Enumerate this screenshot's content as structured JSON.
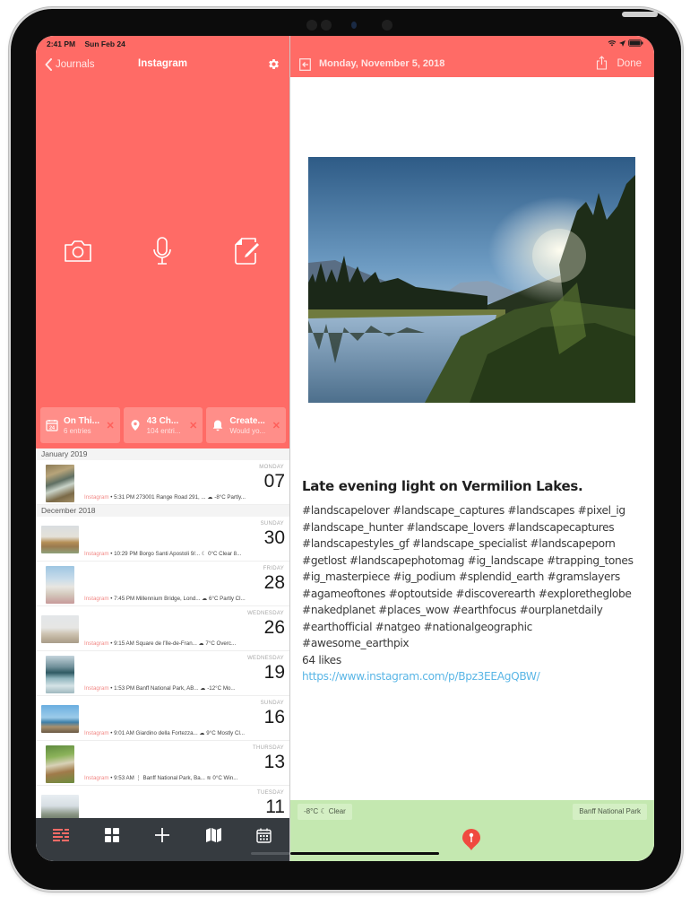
{
  "colors": {
    "accent": "#ff6b66",
    "card": "#ff8e89",
    "tabbar": "#363b40",
    "tab_active": "#ff6b66",
    "link": "#5ab6e6",
    "map": "#c4e8b0",
    "pin": "#f04a3f"
  },
  "status_bar": {
    "time": "2:41 PM",
    "date": "Sun Feb 24",
    "icons": [
      "wifi-icon",
      "location-arrow-icon",
      "battery-icon"
    ]
  },
  "left_nav": {
    "back_label": "Journals",
    "title": "Instagram",
    "settings_icon": "gear-icon"
  },
  "quick_actions": [
    {
      "icon": "camera-icon",
      "label": "Camera"
    },
    {
      "icon": "microphone-icon",
      "label": "Audio"
    },
    {
      "icon": "new-entry-icon",
      "label": "New Entry"
    }
  ],
  "cards": [
    {
      "icon": "calendar-24-icon",
      "title": "On Thi...",
      "subtitle": "6 entries"
    },
    {
      "icon": "location-pin-icon",
      "title": "43 Ch...",
      "subtitle": "104 entri..."
    },
    {
      "icon": "bell-icon",
      "title": "Create...",
      "subtitle": "Would yo..."
    }
  ],
  "sections": [
    {
      "header": "January 2019",
      "entries": [
        {
          "weekday": "MONDAY",
          "day": "07",
          "journal": "Instagram",
          "meta": " • 5:31 PM 273001 Range Road 291, ...  ☁ -8°C Partly...",
          "thumb": "waterfall"
        }
      ]
    },
    {
      "header": "December 2018",
      "entries": [
        {
          "weekday": "SUNDAY",
          "day": "30",
          "journal": "Instagram",
          "meta": " • 10:29 PM Borgo Santi Apostoli 9/...  ☾ 0°C Clear  8...",
          "thumb": "bridge"
        },
        {
          "weekday": "FRIDAY",
          "day": "28",
          "journal": "Instagram",
          "meta": " • 7:45 PM Millennium Bridge, Lond...  ☁ 6°C Partly Cl...",
          "thumb": "cathedral"
        },
        {
          "weekday": "WEDNESDAY",
          "day": "26",
          "journal": "Instagram",
          "meta": " • 9:15 AM Square de l'Île-de-Fran...  ☁ 7°C Overc...",
          "thumb": "paris"
        },
        {
          "weekday": "WEDNESDAY",
          "day": "19",
          "journal": "Instagram",
          "meta": " • 1:53 PM Banff National Park, AB...  ☁ -12°C Mo...",
          "thumb": "lake"
        },
        {
          "weekday": "SUNDAY",
          "day": "16",
          "journal": "Instagram",
          "meta": " • 9:01 AM Giardino della Fortezza...  ☁ 9°C Mostly Cl...",
          "thumb": "sea"
        },
        {
          "weekday": "THURSDAY",
          "day": "13",
          "journal": "Instagram",
          "meta": " • 9:53 AM  ⋮  Banff National Park, Ba...  ≋ 0°C Win...",
          "thumb": "garden"
        },
        {
          "weekday": "TUESDAY",
          "day": "11",
          "journal": "",
          "meta": "",
          "thumb": "snow"
        }
      ]
    }
  ],
  "tabbar": [
    {
      "icon": "timeline-list-icon",
      "label": "List",
      "active": true
    },
    {
      "icon": "media-grid-icon",
      "label": "Media",
      "active": false
    },
    {
      "icon": "plus-icon",
      "label": "New",
      "active": false
    },
    {
      "icon": "map-icon",
      "label": "Map",
      "active": false
    },
    {
      "icon": "calendar-icon",
      "label": "Calendar",
      "active": false
    }
  ],
  "entry": {
    "date": "Monday, November 5, 2018",
    "done_label": "Done",
    "photo_alt": "Lake with reflection, evergreen trees and sunlight over mountains",
    "title": "Late evening light on Vermilion Lakes.",
    "hashtag_lines": [
      "#landscapelover #landscape_captures #landscapes #pixel_ig",
      "#landscape_hunter #landscape_lovers #landscapecaptures",
      "#landscapestyles_gf #landscape_specialist #landscapeporn",
      "#getlost #landscapephotomag #ig_landscape #trapping_tones",
      "#ig_masterpiece #ig_podium #splendid_earth #gramslayers",
      "#agameoftones #optoutside #discoverearth #exploretheglobe",
      "#nakedplanet #places_wow #earthfocus #ourplanetdaily",
      "#earthofficial #natgeo #nationalgeographic",
      "#awesome_earthpix"
    ],
    "likes": "64 likes",
    "link": "https://www.instagram.com/p/Bpz3EEAgQBW/"
  },
  "map": {
    "weather": "-8°C ☾ Clear",
    "place": "Banff National Park"
  }
}
